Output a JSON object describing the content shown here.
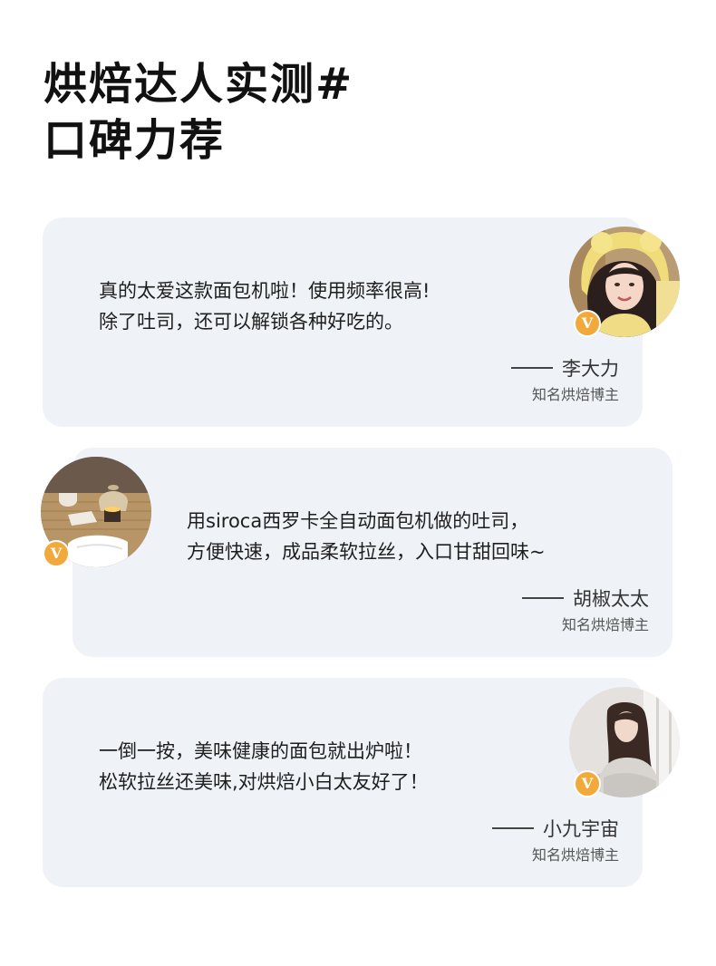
{
  "headline": {
    "line1": "烘焙达人实测#",
    "line2": "口碑力荐"
  },
  "reviews": [
    {
      "line1": "真的太爱这款面包机啦！使用频率很高!",
      "line2": "除了吐司，还可以解锁各种好吃的。",
      "name": "李大力",
      "title": "知名烘焙博主",
      "badge": "V",
      "avatar_icon": "woman-in-plush-hat-portrait"
    },
    {
      "line1": "用siroca西罗卡全自动面包机做的吐司，",
      "line2": "方便快速，成品柔软拉丝，入口甘甜回味~",
      "name": "胡椒太太",
      "title": "知名烘焙博主",
      "badge": "V",
      "avatar_icon": "teapot-and-candle-table-photo"
    },
    {
      "line1": "一倒一按，美味健康的面包就出炉啦！",
      "line2": "松软拉丝还美味,对烘焙小白太友好了！",
      "name": "小九宇宙",
      "title": "知名烘焙博主",
      "badge": "V",
      "avatar_icon": "woman-long-hair-bright-room-photo"
    }
  ],
  "colors": {
    "card_background": "#eff2f7",
    "badge": "#f2a93b",
    "headline": "#111111"
  }
}
